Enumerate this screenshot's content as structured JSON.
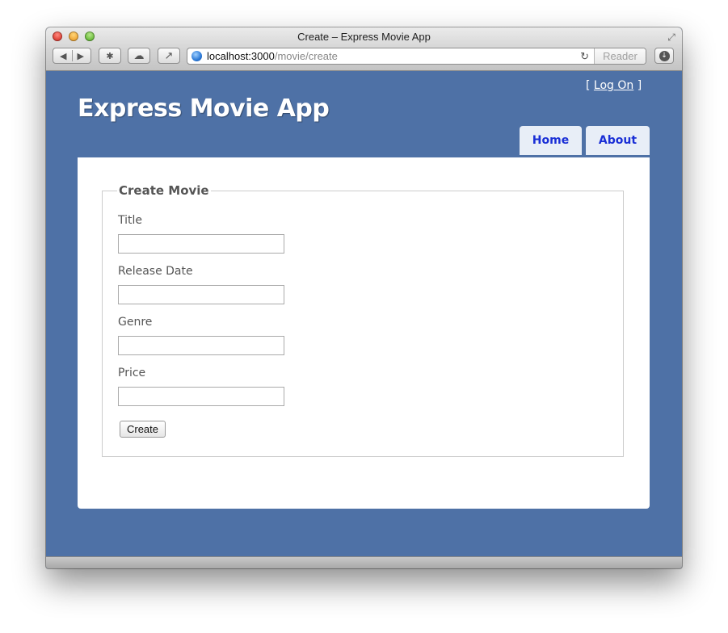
{
  "window": {
    "title": "Create – Express Movie App"
  },
  "toolbar": {
    "url_host": "localhost:3000",
    "url_path": "/movie/create",
    "reader_label": "Reader",
    "back_icon": "◀",
    "forward_icon": "▶",
    "bug_icon": "✱",
    "cloud_icon": "☁",
    "share_icon": "↗",
    "reload_icon": "↻",
    "download_icon": "↓",
    "fullscreen_icon": "⤢"
  },
  "page": {
    "login_prefix": "[ ",
    "login_link": "Log On",
    "login_suffix": " ]",
    "site_title": "Express Movie App",
    "nav": [
      {
        "label": "Home"
      },
      {
        "label": "About"
      }
    ],
    "form": {
      "legend": "Create Movie",
      "fields": [
        {
          "label": "Title",
          "value": ""
        },
        {
          "label": "Release Date",
          "value": ""
        },
        {
          "label": "Genre",
          "value": ""
        },
        {
          "label": "Price",
          "value": ""
        }
      ],
      "submit_label": "Create"
    }
  },
  "colors": {
    "page_background": "#4e71a6",
    "tab_text": "#1a2fd6",
    "tab_background": "#e8eef7"
  }
}
